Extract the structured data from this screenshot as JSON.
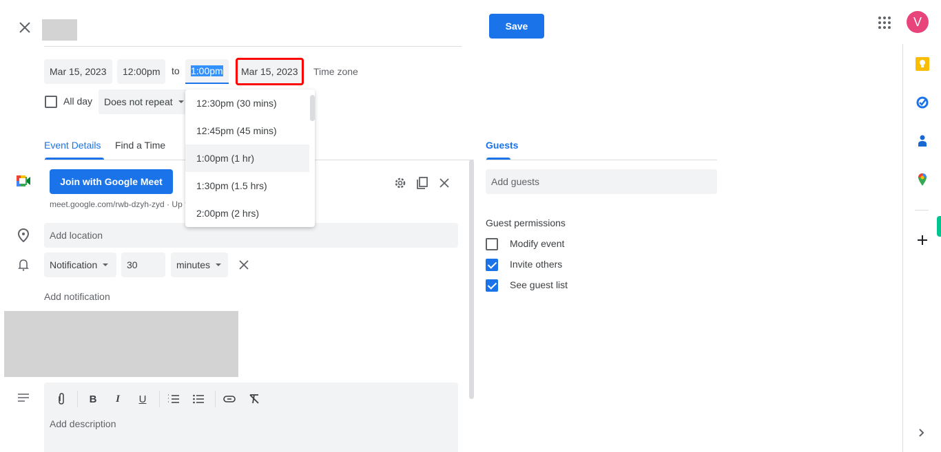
{
  "header": {
    "close_label": "Close",
    "save_label": "Save",
    "avatar_initial": "V",
    "avatar_color": "#e8437b",
    "accent_color": "#1a73e8"
  },
  "datetime": {
    "start_date": "Mar 15, 2023",
    "start_time": "12:00pm",
    "to_label": "to",
    "end_time": "1:00pm",
    "end_date": "Mar 15, 2023",
    "time_zone_label": "Time zone",
    "all_day_label": "All day",
    "all_day_checked": false,
    "repeat_value": "Does not repeat"
  },
  "end_time_dropdown": {
    "options": [
      {
        "label": "12:30pm (30 mins)",
        "selected": false
      },
      {
        "label": "12:45pm (45 mins)",
        "selected": false
      },
      {
        "label": "1:00pm (1 hr)",
        "selected": true
      },
      {
        "label": "1:30pm (1.5 hrs)",
        "selected": false
      },
      {
        "label": "2:00pm (2 hrs)",
        "selected": false
      }
    ]
  },
  "tabs": {
    "event_details": "Event Details",
    "find_a_time": "Find a Time",
    "guests": "Guests"
  },
  "meet": {
    "join_label": "Join with Google Meet",
    "link_text": "meet.google.com/rwb-dzyh-zyd · Up t"
  },
  "location": {
    "placeholder": "Add location"
  },
  "notification": {
    "type": "Notification",
    "value": "30",
    "unit": "minutes",
    "add_label": "Add notification"
  },
  "description": {
    "placeholder": "Add description",
    "toolbar": [
      "attach-icon",
      "bold-icon",
      "italic-icon",
      "underline-icon",
      "numbered-list-icon",
      "bulleted-list-icon",
      "link-icon",
      "remove-formatting-icon"
    ]
  },
  "guests": {
    "placeholder": "Add guests",
    "permissions_title": "Guest permissions",
    "permissions": [
      {
        "label": "Modify event",
        "checked": false
      },
      {
        "label": "Invite others",
        "checked": true
      },
      {
        "label": "See guest list",
        "checked": true
      }
    ]
  },
  "side_panel": {
    "apps": [
      "keep-icon",
      "tasks-icon",
      "contacts-icon",
      "maps-icon"
    ],
    "add_label": "+",
    "expand_label": "›"
  }
}
